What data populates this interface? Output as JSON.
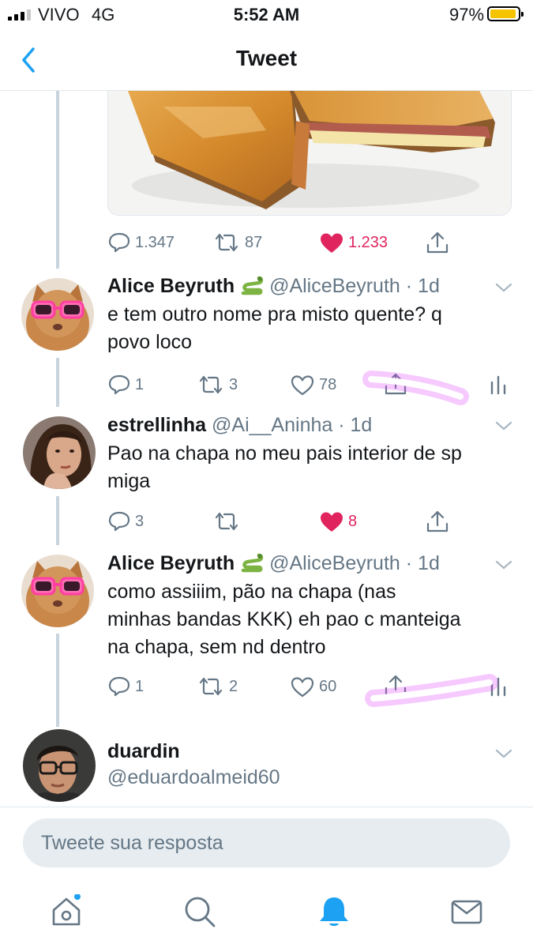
{
  "status_bar": {
    "carrier": "VIVO",
    "network": "4G",
    "time": "5:52 AM",
    "battery": "97%"
  },
  "header": {
    "title": "Tweet",
    "back_icon": "chevron-left-icon"
  },
  "top_tweet": {
    "replies": "1.347",
    "retweets": "87",
    "likes": "1.233",
    "liked": true
  },
  "tweets": [
    {
      "name": "Alice Beyruth",
      "emoji": "snake",
      "handle": "@AliceBeyruth",
      "time": "· 1d",
      "text": [
        "e tem outro nome pra misto quente? q",
        "povo loco"
      ],
      "replies": "1",
      "retweets": "3",
      "likes": "78",
      "liked": false
    },
    {
      "name": "estrellinha",
      "handle": "@Ai__Aninha",
      "time": "· 1d",
      "text": [
        "Pao na chapa no meu pais interior de sp",
        "miga"
      ],
      "replies": "3",
      "retweets": "",
      "likes": "8",
      "liked": true
    },
    {
      "name": "Alice Beyruth",
      "emoji": "snake",
      "handle": "@AliceBeyruth",
      "time": "· 1d",
      "text": [
        "como assiiim, pão na chapa (nas",
        "minhas bandas KKK) eh pao c manteiga",
        "na chapa, sem nd dentro"
      ],
      "replies": "1",
      "retweets": "2",
      "likes": "60",
      "liked": false
    },
    {
      "name": "duardin",
      "handle": "@eduardoalmeid60"
    }
  ],
  "reply_box": {
    "placeholder": "Tweete sua resposta"
  },
  "tab_bar": {
    "items": [
      "home-icon",
      "search-icon",
      "notifications-icon",
      "messages-icon"
    ],
    "active": "notifications-icon"
  },
  "colors": {
    "accent": "#1da1f2",
    "like": "#e0245e",
    "muted": "#657786",
    "highlight": "#e040fb"
  }
}
